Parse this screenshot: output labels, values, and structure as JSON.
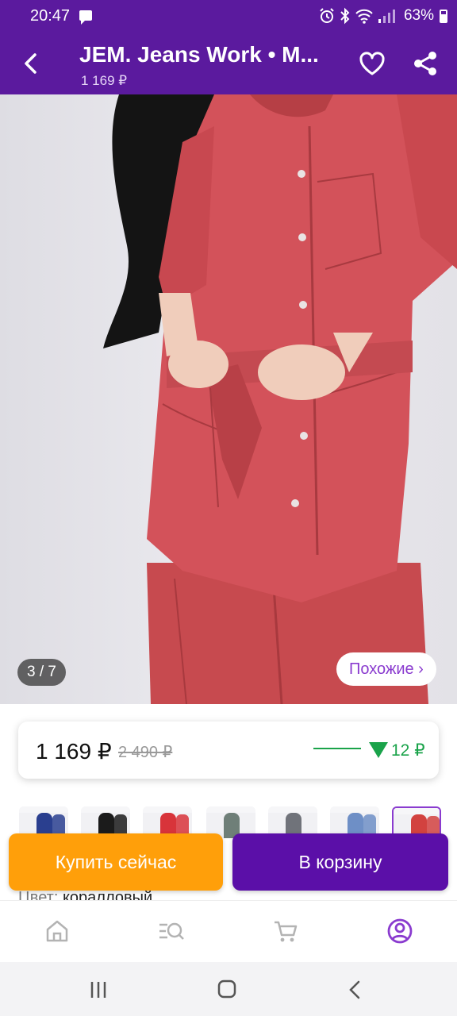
{
  "status_bar": {
    "time": "20:47",
    "battery": "63%"
  },
  "app_bar": {
    "title": "JEM. Jeans Work • M...",
    "subtitle": "1 169 ₽"
  },
  "gallery": {
    "counter": "3 / 7",
    "similar_label": "Похожие ›",
    "thumbnails": [
      {
        "color": "#2a3f8f"
      },
      {
        "color": "#1b1b1b"
      },
      {
        "color": "#d8343a"
      },
      {
        "color": "#6f7f78"
      },
      {
        "color": "#70737a"
      },
      {
        "color": "#6e8fc6"
      },
      {
        "color": "#d2423f"
      }
    ],
    "selected_thumbnail": 6
  },
  "price": {
    "current": "1 169 ₽",
    "old": "2 490 ₽",
    "drop": "12 ₽",
    "drop_color": "#1aa34a"
  },
  "actions": {
    "buy_now": "Купить сейчас",
    "add_to_cart": "В корзину"
  },
  "details": {
    "color_label": "Цвет: ",
    "color_value": "коралловый"
  },
  "bottom_nav": {
    "items": [
      "home-icon",
      "catalog-search-icon",
      "cart-icon",
      "profile-icon"
    ],
    "active_color": "#8a3bcf"
  },
  "colors": {
    "brand": "#5b1a9e",
    "buy_now": "#ff9f0a",
    "add_to_cart": "#5b0fa8"
  }
}
